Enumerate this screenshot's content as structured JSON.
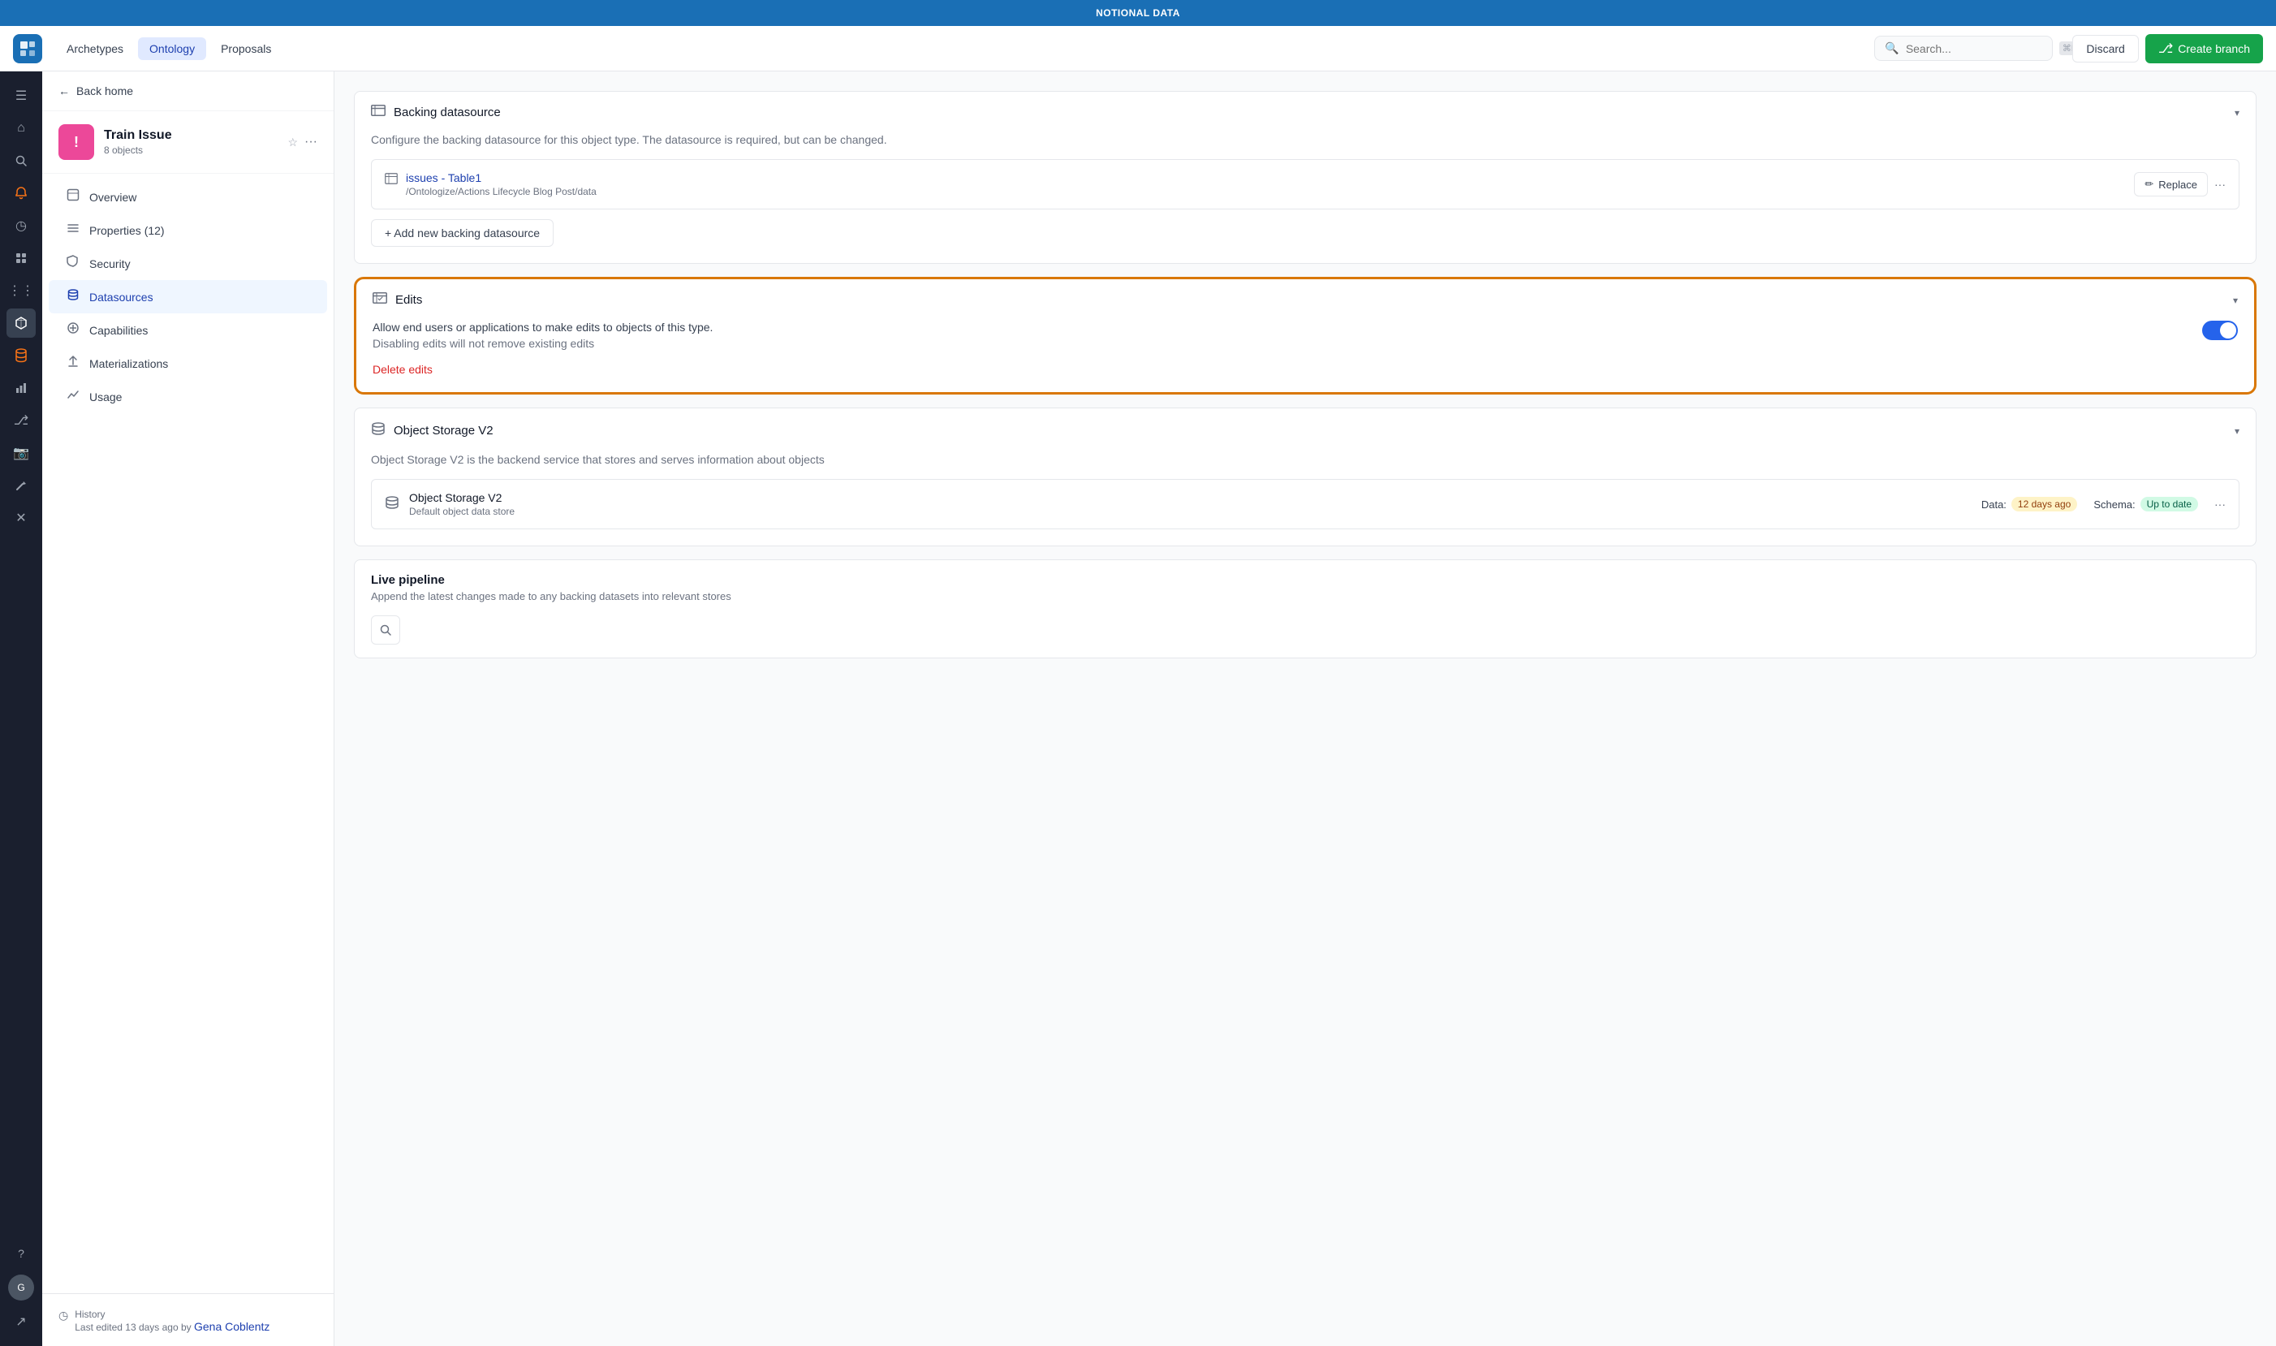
{
  "app": {
    "top_bar_title": "NOTIONAL DATA"
  },
  "nav": {
    "logo_icon": "◻",
    "tabs": [
      {
        "id": "archetypes",
        "label": "Archetypes",
        "active": false
      },
      {
        "id": "ontology",
        "label": "Ontology",
        "active": true
      },
      {
        "id": "proposals",
        "label": "Proposals",
        "active": false
      }
    ],
    "search_placeholder": "Search...",
    "search_shortcut": "⌘K",
    "discard_label": "Discard",
    "create_branch_label": "Create branch"
  },
  "icon_sidebar": {
    "icons": [
      {
        "name": "menu-icon",
        "symbol": "☰"
      },
      {
        "name": "home-icon",
        "symbol": "⌂"
      },
      {
        "name": "search-icon",
        "symbol": "🔍"
      },
      {
        "name": "notification-icon",
        "symbol": "🔔"
      },
      {
        "name": "history-icon",
        "symbol": "◷"
      },
      {
        "name": "layers-icon",
        "symbol": "⊞"
      },
      {
        "name": "grid-icon",
        "symbol": "⋮⋮"
      },
      {
        "name": "cube-icon",
        "symbol": "◈"
      },
      {
        "name": "database-icon",
        "symbol": "🗄"
      },
      {
        "name": "chart-icon",
        "symbol": "📊"
      },
      {
        "name": "branch-icon",
        "symbol": "⎇"
      },
      {
        "name": "camera-icon",
        "symbol": "📷"
      },
      {
        "name": "git-icon",
        "symbol": "⌥"
      },
      {
        "name": "wrench-icon",
        "symbol": "🔧"
      },
      {
        "name": "xray-icon",
        "symbol": "✕"
      },
      {
        "name": "help-icon",
        "symbol": "?"
      },
      {
        "name": "expand-icon",
        "symbol": "↗"
      }
    ]
  },
  "left_panel": {
    "back_label": "Back home",
    "object": {
      "name": "Train Issue",
      "count": "8 objects",
      "icon": "!"
    },
    "nav_items": [
      {
        "id": "overview",
        "label": "Overview",
        "icon": "🖥",
        "active": false
      },
      {
        "id": "properties",
        "label": "Properties (12)",
        "icon": "☰",
        "active": false
      },
      {
        "id": "security",
        "label": "Security",
        "icon": "🛡",
        "active": false
      },
      {
        "id": "datasources",
        "label": "Datasources",
        "icon": "🗄",
        "active": true
      },
      {
        "id": "capabilities",
        "label": "Capabilities",
        "icon": "⊕",
        "active": false
      },
      {
        "id": "materializations",
        "label": "Materializations",
        "icon": "↑",
        "active": false
      },
      {
        "id": "usage",
        "label": "Usage",
        "icon": "📈",
        "active": false
      }
    ],
    "footer": {
      "history_label": "History",
      "history_text": "Last edited 13 days ago by ",
      "history_author": "Gena Coblentz"
    }
  },
  "main": {
    "backing_datasource": {
      "title": "Backing datasource",
      "description": "Configure the backing datasource for this object type. The datasource is required, but can be changed.",
      "table_name": "issues - Table1",
      "table_path": "/Ontologize/Actions Lifecycle Blog Post/data",
      "replace_label": "Replace",
      "add_label": "+ Add new backing datasource",
      "more_icon": "···"
    },
    "edits": {
      "title": "Edits",
      "toggle_on": true,
      "description_line1": "Allow end users or applications to make edits to objects of this type.",
      "description_line2": "Disabling edits will not remove existing edits",
      "delete_label": "Delete edits",
      "highlighted": true
    },
    "object_storage": {
      "title": "Object Storage V2",
      "description": "Object Storage V2 is the backend service that stores and serves information about objects",
      "item_name": "Object Storage V2",
      "item_desc": "Default object data store",
      "data_label": "Data:",
      "data_value": "12 days ago",
      "schema_label": "Schema:",
      "schema_value": "Up to date",
      "more_icon": "···"
    },
    "live_pipeline": {
      "title": "Live pipeline",
      "description": "Append the latest changes made to any backing datasets into relevant stores"
    }
  }
}
